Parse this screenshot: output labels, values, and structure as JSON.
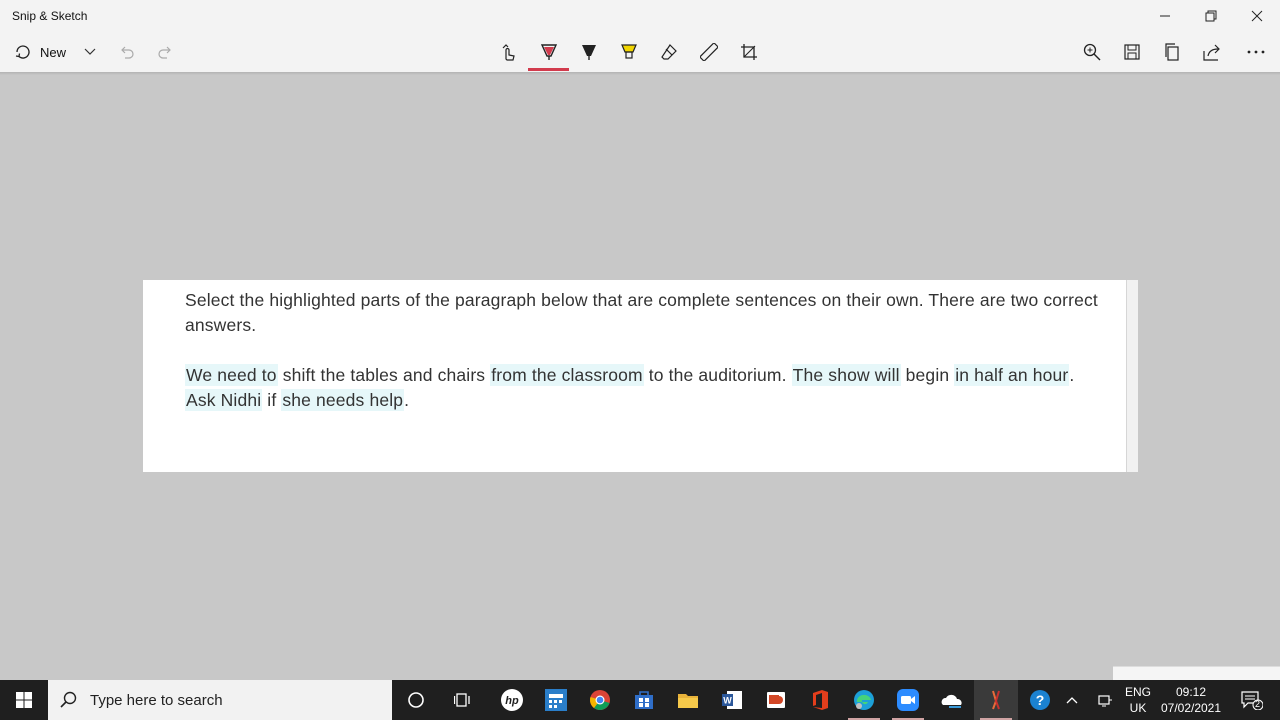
{
  "window": {
    "title": "Snip & Sketch"
  },
  "toolbar": {
    "new_label": "New",
    "icons": [
      "new-snip-icon",
      "chevron-down-icon",
      "undo-icon",
      "redo-icon",
      "touch-writing-icon",
      "ballpoint-pen-icon",
      "pencil-icon",
      "highlighter-icon",
      "eraser-icon",
      "ruler-icon",
      "crop-icon",
      "zoom-icon",
      "save-icon",
      "copy-icon",
      "share-icon",
      "more-icon"
    ],
    "active_color": "#d23b4d"
  },
  "snip": {
    "question": "Select the highlighted parts of the paragraph below that are complete sentences on their own. There are two correct answers.",
    "paragraph": [
      {
        "text": "We need to",
        "highlight": true
      },
      {
        "text": " shift the tables and chairs ",
        "highlight": false
      },
      {
        "text": "from the classroom",
        "highlight": true
      },
      {
        "text": " to the auditorium. ",
        "highlight": false
      },
      {
        "text": "The show will",
        "highlight": true
      },
      {
        "text": " begin ",
        "highlight": false
      },
      {
        "text": "in half an hour",
        "highlight": true
      },
      {
        "text": ". ",
        "highlight": false
      },
      {
        "text": "Ask Nidhi",
        "highlight": true
      },
      {
        "text": " if ",
        "highlight": false
      },
      {
        "text": "she needs help",
        "highlight": true
      },
      {
        "text": ".",
        "highlight": false
      }
    ],
    "highlight_color": "#e6f7f9"
  },
  "taskbar": {
    "search_placeholder": "Type here to search",
    "apps": [
      "cortana-icon",
      "task-view-icon",
      "hp-icon",
      "calculator-app-icon",
      "chrome-icon",
      "store-icon",
      "file-explorer-icon",
      "word-icon",
      "powerpoint-icon",
      "office-icon",
      "edge-icon",
      "zoom-app-icon",
      "onedrive-icon",
      "snip-sketch-icon",
      "help-icon"
    ],
    "language": "ENG",
    "region": "UK",
    "time": "09:12",
    "date": "07/02/2021",
    "notification_count": "2"
  }
}
